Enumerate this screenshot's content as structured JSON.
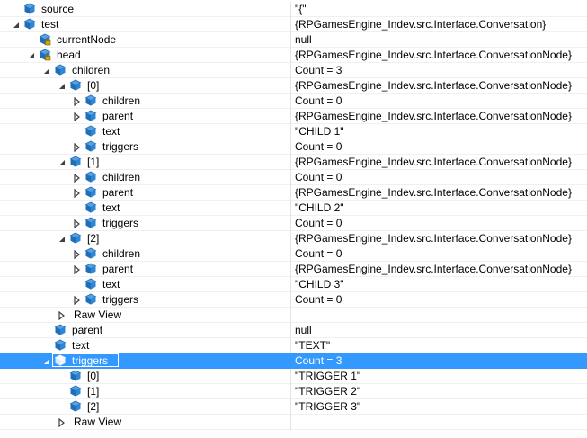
{
  "watch": {
    "rows": [
      {
        "name": "source",
        "value": "\"{\"",
        "depth": 0,
        "expander": "none",
        "icon": "field-icon"
      },
      {
        "name": "test",
        "value": "{RPGamesEngine_Indev.src.Interface.Conversation}",
        "depth": 0,
        "expander": "expanded",
        "icon": "field-icon"
      },
      {
        "name": "currentNode",
        "value": "null",
        "depth": 1,
        "expander": "none",
        "icon": "private-field-icon"
      },
      {
        "name": "head",
        "value": "{RPGamesEngine_Indev.src.Interface.ConversationNode}",
        "depth": 1,
        "expander": "expanded",
        "icon": "private-field-icon"
      },
      {
        "name": "children",
        "value": "Count = 3",
        "depth": 2,
        "expander": "expanded",
        "icon": "field-icon"
      },
      {
        "name": "[0]",
        "value": "{RPGamesEngine_Indev.src.Interface.ConversationNode}",
        "depth": 3,
        "expander": "expanded",
        "icon": "field-icon"
      },
      {
        "name": "children",
        "value": "Count = 0",
        "depth": 4,
        "expander": "collapsed",
        "icon": "field-icon"
      },
      {
        "name": "parent",
        "value": "{RPGamesEngine_Indev.src.Interface.ConversationNode}",
        "depth": 4,
        "expander": "collapsed",
        "icon": "field-icon"
      },
      {
        "name": "text",
        "value": "\"CHILD 1\"",
        "depth": 4,
        "expander": "none",
        "icon": "field-icon"
      },
      {
        "name": "triggers",
        "value": "Count = 0",
        "depth": 4,
        "expander": "collapsed",
        "icon": "field-icon"
      },
      {
        "name": "[1]",
        "value": "{RPGamesEngine_Indev.src.Interface.ConversationNode}",
        "depth": 3,
        "expander": "expanded",
        "icon": "field-icon"
      },
      {
        "name": "children",
        "value": "Count = 0",
        "depth": 4,
        "expander": "collapsed",
        "icon": "field-icon"
      },
      {
        "name": "parent",
        "value": "{RPGamesEngine_Indev.src.Interface.ConversationNode}",
        "depth": 4,
        "expander": "collapsed",
        "icon": "field-icon"
      },
      {
        "name": "text",
        "value": "\"CHILD 2\"",
        "depth": 4,
        "expander": "none",
        "icon": "field-icon"
      },
      {
        "name": "triggers",
        "value": "Count = 0",
        "depth": 4,
        "expander": "collapsed",
        "icon": "field-icon"
      },
      {
        "name": "[2]",
        "value": "{RPGamesEngine_Indev.src.Interface.ConversationNode}",
        "depth": 3,
        "expander": "expanded",
        "icon": "field-icon"
      },
      {
        "name": "children",
        "value": "Count = 0",
        "depth": 4,
        "expander": "collapsed",
        "icon": "field-icon"
      },
      {
        "name": "parent",
        "value": "{RPGamesEngine_Indev.src.Interface.ConversationNode}",
        "depth": 4,
        "expander": "collapsed",
        "icon": "field-icon"
      },
      {
        "name": "text",
        "value": "\"CHILD 3\"",
        "depth": 4,
        "expander": "none",
        "icon": "field-icon"
      },
      {
        "name": "triggers",
        "value": "Count = 0",
        "depth": 4,
        "expander": "collapsed",
        "icon": "field-icon"
      },
      {
        "name": "Raw View",
        "value": "",
        "depth": 3,
        "expander": "collapsed",
        "icon": "none"
      },
      {
        "name": "parent",
        "value": "null",
        "depth": 2,
        "expander": "none",
        "icon": "field-icon"
      },
      {
        "name": "text",
        "value": "\"TEXT\"",
        "depth": 2,
        "expander": "none",
        "icon": "field-icon"
      },
      {
        "name": "triggers",
        "value": "Count = 3",
        "depth": 2,
        "expander": "expanded",
        "icon": "field-icon",
        "selected": true
      },
      {
        "name": "[0]",
        "value": "\"TRIGGER 1\"",
        "depth": 3,
        "expander": "none",
        "icon": "field-icon"
      },
      {
        "name": "[1]",
        "value": "\"TRIGGER 2\"",
        "depth": 3,
        "expander": "none",
        "icon": "field-icon"
      },
      {
        "name": "[2]",
        "value": "\"TRIGGER 3\"",
        "depth": 3,
        "expander": "none",
        "icon": "field-icon"
      },
      {
        "name": "Raw View",
        "value": "",
        "depth": 3,
        "expander": "collapsed",
        "icon": "none"
      }
    ]
  },
  "colors": {
    "selection": "#3399ff",
    "icon_blue": "#1e6fb8",
    "expander": "#404040"
  }
}
